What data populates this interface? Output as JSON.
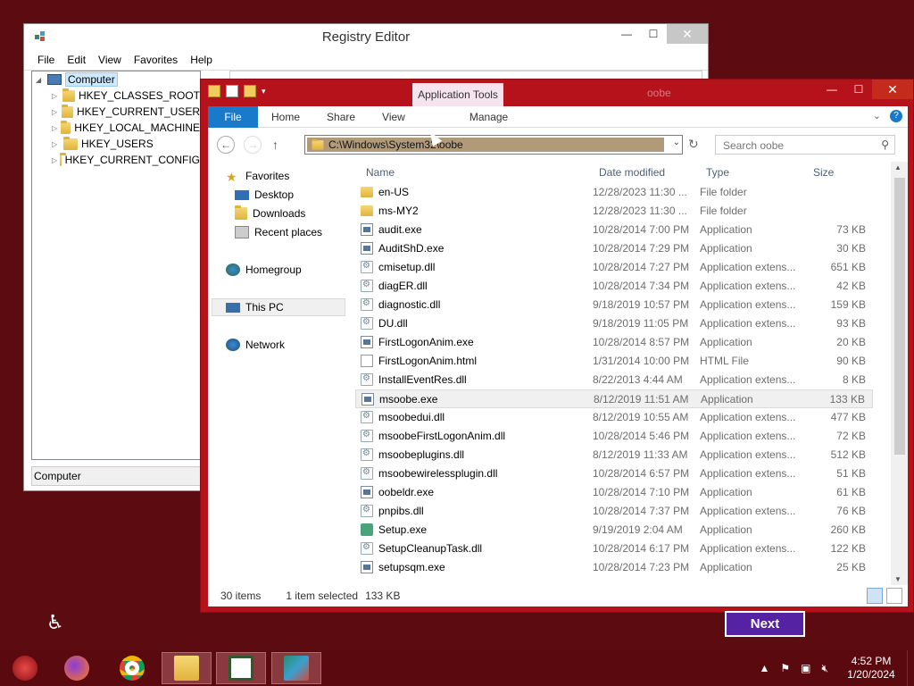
{
  "registry": {
    "title": "Registry Editor",
    "menu": [
      "File",
      "Edit",
      "View",
      "Favorites",
      "Help"
    ],
    "tree_root": "Computer",
    "tree_items": [
      "HKEY_CLASSES_ROOT",
      "HKEY_CURRENT_USER",
      "HKEY_LOCAL_MACHINE",
      "HKEY_USERS",
      "HKEY_CURRENT_CONFIG"
    ],
    "status": "Computer"
  },
  "explorer": {
    "app_tools": "Application Tools",
    "window_title": "oobe",
    "ribbon_tabs": [
      "File",
      "Home",
      "Share",
      "View",
      "Manage"
    ],
    "address": "C:\\Windows\\System32\\oobe",
    "search_placeholder": "Search oobe",
    "nav": {
      "favorites": "Favorites",
      "desktop": "Desktop",
      "downloads": "Downloads",
      "recent": "Recent places",
      "homegroup": "Homegroup",
      "thispc": "This PC",
      "network": "Network"
    },
    "columns": {
      "name": "Name",
      "date": "Date modified",
      "type": "Type",
      "size": "Size"
    },
    "files": [
      {
        "name": "en-US",
        "date": "12/28/2023 11:30 ...",
        "type": "File folder",
        "size": "",
        "icon": "folder"
      },
      {
        "name": "ms-MY2",
        "date": "12/28/2023 11:30 ...",
        "type": "File folder",
        "size": "",
        "icon": "folder"
      },
      {
        "name": "audit.exe",
        "date": "10/28/2014 7:00 PM",
        "type": "Application",
        "size": "73 KB",
        "icon": "exe"
      },
      {
        "name": "AuditShD.exe",
        "date": "10/28/2014 7:29 PM",
        "type": "Application",
        "size": "30 KB",
        "icon": "exe"
      },
      {
        "name": "cmisetup.dll",
        "date": "10/28/2014 7:27 PM",
        "type": "Application extens...",
        "size": "651 KB",
        "icon": "dll"
      },
      {
        "name": "diagER.dll",
        "date": "10/28/2014 7:34 PM",
        "type": "Application extens...",
        "size": "42 KB",
        "icon": "dll"
      },
      {
        "name": "diagnostic.dll",
        "date": "9/18/2019 10:57 PM",
        "type": "Application extens...",
        "size": "159 KB",
        "icon": "dll"
      },
      {
        "name": "DU.dll",
        "date": "9/18/2019 11:05 PM",
        "type": "Application extens...",
        "size": "93 KB",
        "icon": "dll"
      },
      {
        "name": "FirstLogonAnim.exe",
        "date": "10/28/2014 8:57 PM",
        "type": "Application",
        "size": "20 KB",
        "icon": "exe"
      },
      {
        "name": "FirstLogonAnim.html",
        "date": "1/31/2014 10:00 PM",
        "type": "HTML File",
        "size": "90 KB",
        "icon": "html"
      },
      {
        "name": "InstallEventRes.dll",
        "date": "8/22/2013 4:44 AM",
        "type": "Application extens...",
        "size": "8 KB",
        "icon": "dll"
      },
      {
        "name": "msoobe.exe",
        "date": "8/12/2019 11:51 AM",
        "type": "Application",
        "size": "133 KB",
        "icon": "exe",
        "selected": true
      },
      {
        "name": "msoobedui.dll",
        "date": "8/12/2019 10:55 AM",
        "type": "Application extens...",
        "size": "477 KB",
        "icon": "dll"
      },
      {
        "name": "msoobeFirstLogonAnim.dll",
        "date": "10/28/2014 5:46 PM",
        "type": "Application extens...",
        "size": "72 KB",
        "icon": "dll"
      },
      {
        "name": "msoobeplugins.dll",
        "date": "8/12/2019 11:33 AM",
        "type": "Application extens...",
        "size": "512 KB",
        "icon": "dll"
      },
      {
        "name": "msoobewirelessplugin.dll",
        "date": "10/28/2014 6:57 PM",
        "type": "Application extens...",
        "size": "51 KB",
        "icon": "dll"
      },
      {
        "name": "oobeldr.exe",
        "date": "10/28/2014 7:10 PM",
        "type": "Application",
        "size": "61 KB",
        "icon": "exe"
      },
      {
        "name": "pnpibs.dll",
        "date": "10/28/2014 7:37 PM",
        "type": "Application extens...",
        "size": "76 KB",
        "icon": "dll"
      },
      {
        "name": "Setup.exe",
        "date": "9/19/2019 2:04 AM",
        "type": "Application",
        "size": "260 KB",
        "icon": "setup"
      },
      {
        "name": "SetupCleanupTask.dll",
        "date": "10/28/2014 6:17 PM",
        "type": "Application extens...",
        "size": "122 KB",
        "icon": "dll"
      },
      {
        "name": "setupsqm.exe",
        "date": "10/28/2014 7:23 PM",
        "type": "Application",
        "size": "25 KB",
        "icon": "exe"
      }
    ],
    "status": {
      "items": "30 items",
      "selected": "1 item selected",
      "size": "133 KB"
    }
  },
  "next_label": "Next",
  "clock": {
    "time": "4:52 PM",
    "date": "1/20/2024"
  }
}
